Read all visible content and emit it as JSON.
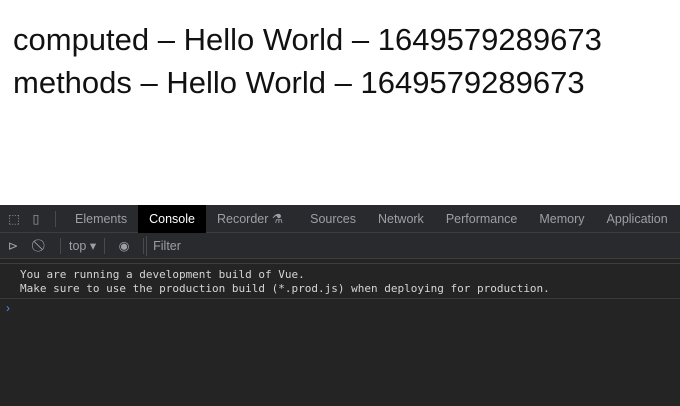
{
  "page": {
    "lines": [
      "computed – Hello World – 1649579289673",
      "methods – Hello World – 1649579289673"
    ]
  },
  "devtools": {
    "tabs": [
      "Elements",
      "Console",
      "Recorder",
      "Sources",
      "Network",
      "Performance",
      "Memory",
      "Application"
    ],
    "active_tab": "Console",
    "context": "top ▾",
    "filter_placeholder": "Filter",
    "messages": [
      "You are running a development build of Vue.",
      "Make sure to use the production build (*.prod.js) when deploying for production."
    ],
    "prompt": "›"
  }
}
